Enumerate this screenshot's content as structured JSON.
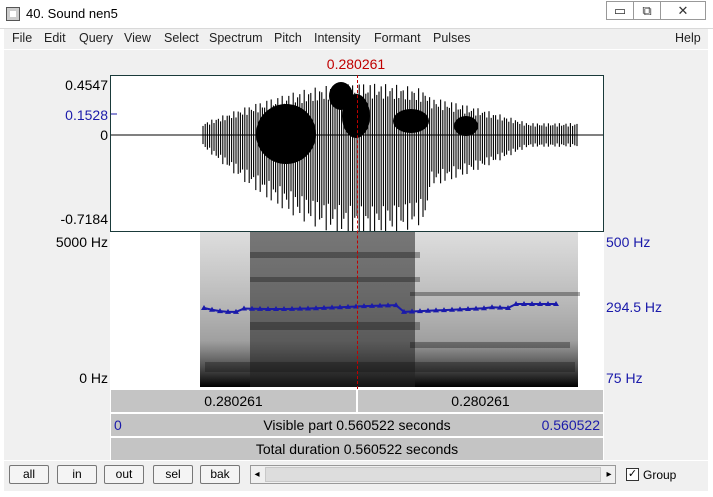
{
  "window": {
    "title": "40. Sound nen5",
    "minimize": "▭",
    "restore": "⧉",
    "close": "✕"
  },
  "menu": [
    "File",
    "Edit",
    "Query",
    "View",
    "Select",
    "Spectrum",
    "Pitch",
    "Intensity",
    "Formant",
    "Pulses",
    "Help"
  ],
  "cursor_time": "0.280261",
  "waveform": {
    "top": "0.4547",
    "mark": "0.1528",
    "zero": "0",
    "bottom": "-0.7184"
  },
  "spectrogram": {
    "top": "5000 Hz",
    "bottom": "0 Hz"
  },
  "pitch": {
    "top": "500 Hz",
    "value": "294.5 Hz",
    "bottom": "75 Hz"
  },
  "time_bar": {
    "left_part": "0.280261",
    "right_part": "0.280261",
    "visible_start": "0",
    "visible_text": "Visible part 0.560522 seconds",
    "visible_end": "0.560522",
    "total_text": "Total duration 0.560522 seconds"
  },
  "buttons": [
    "all",
    "in",
    "out",
    "sel",
    "bak"
  ],
  "scroll": {
    "left_arrow": "◂",
    "right_arrow": "▸"
  },
  "group": {
    "label": "Group",
    "checked": "✓"
  },
  "colors": {
    "cursor": "#c00000",
    "pitch": "#1a1aaa",
    "label_blue": "#1a1aaa"
  }
}
